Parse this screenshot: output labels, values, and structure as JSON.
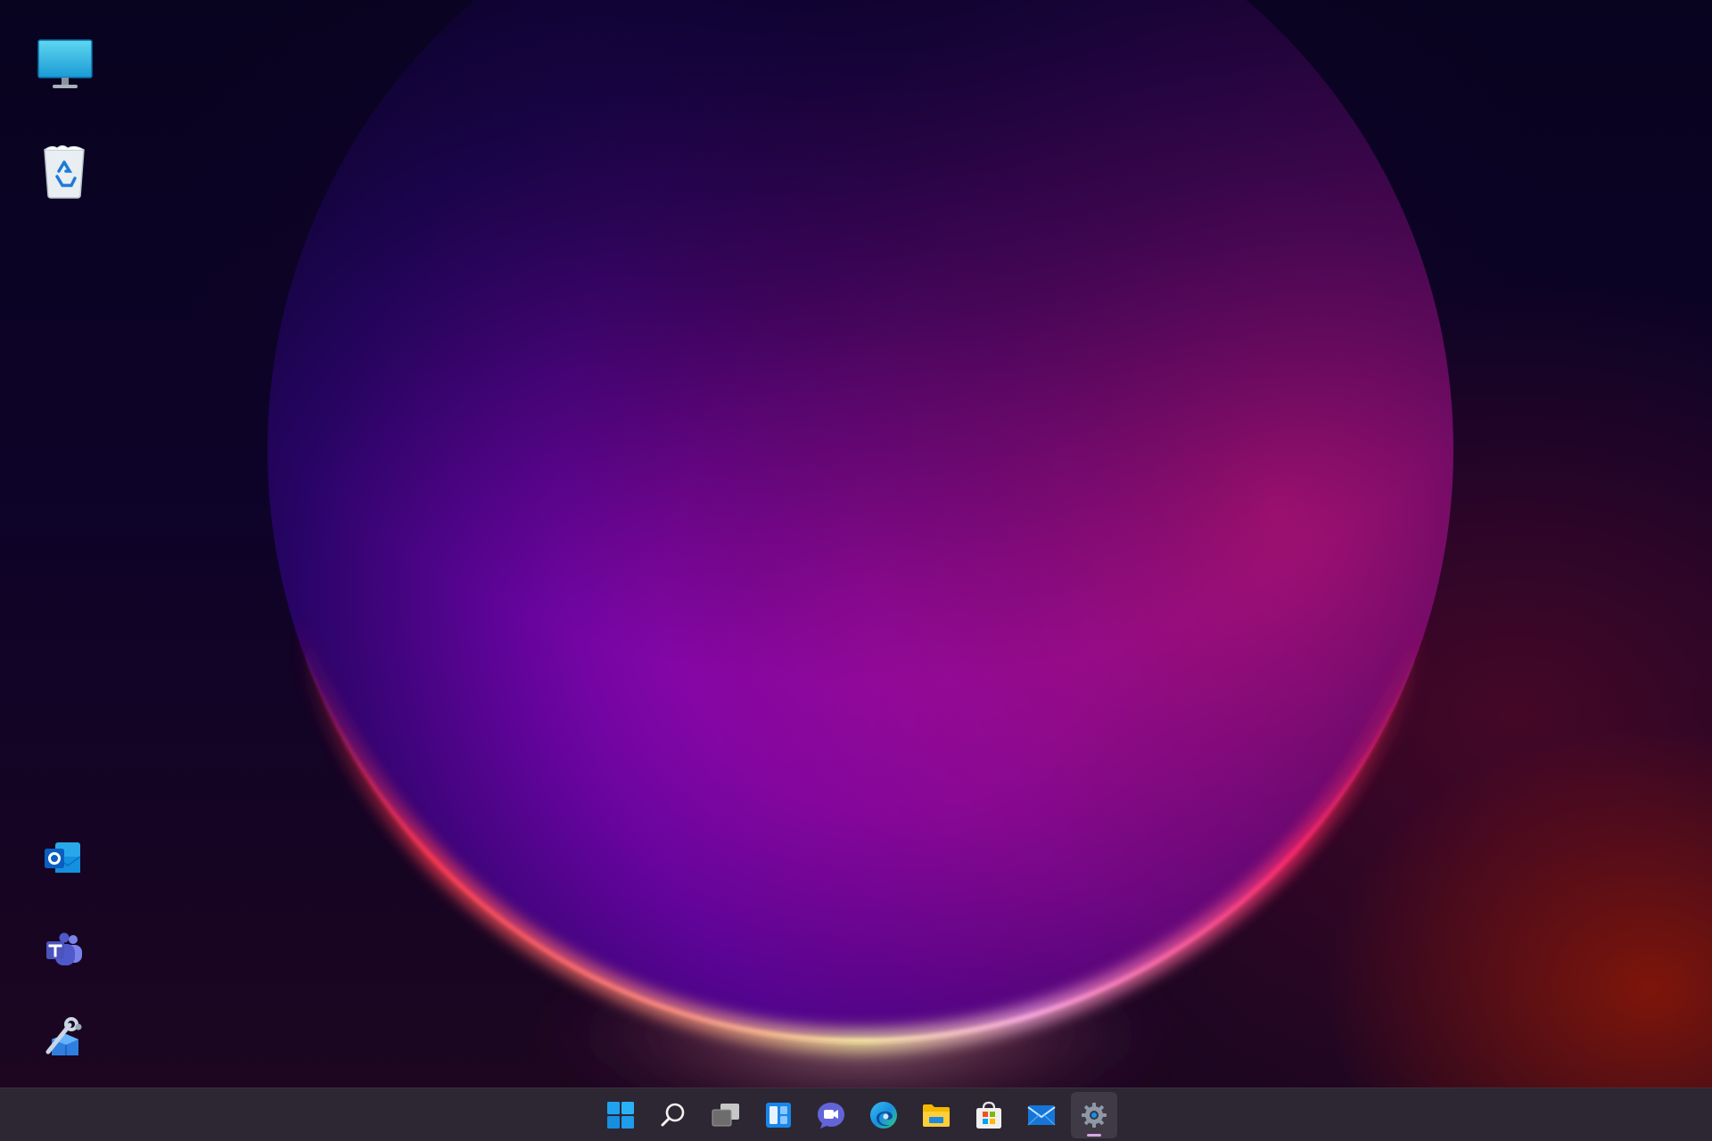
{
  "desktop": {
    "wallpaper": {
      "colors": {
        "background": "#0a0326",
        "orb_purple": "#9a08c4",
        "orb_magenta": "#b0107e",
        "rim_red": "#ff2a4f",
        "rim_yellow": "#fff3a0",
        "corner_red": "#8c1806"
      }
    },
    "icons": [
      {
        "name": "this-pc-icon"
      },
      {
        "name": "recycle-bin-icon"
      },
      {
        "name": "outlook-icon"
      },
      {
        "name": "teams-icon"
      },
      {
        "name": "system-tools-icon"
      }
    ]
  },
  "taskbar": {
    "items": [
      {
        "name": "start-icon"
      },
      {
        "name": "search-icon"
      },
      {
        "name": "task-view-icon"
      },
      {
        "name": "widgets-icon"
      },
      {
        "name": "chat-icon"
      },
      {
        "name": "edge-icon"
      },
      {
        "name": "file-explorer-icon"
      },
      {
        "name": "microsoft-store-icon"
      },
      {
        "name": "mail-icon"
      },
      {
        "name": "settings-icon",
        "active": true
      }
    ],
    "colors": {
      "background": "#241e2c",
      "active_indicator": "#d7a6e8"
    }
  }
}
